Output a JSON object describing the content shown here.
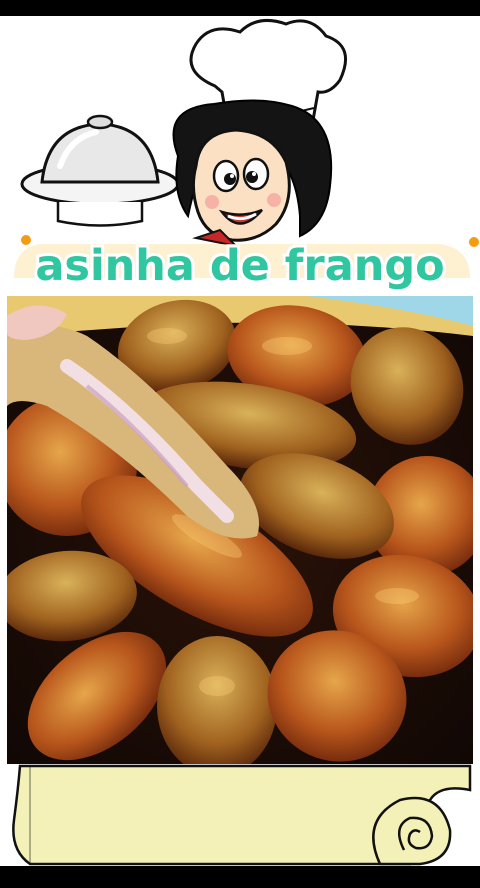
{
  "title": "asinha de frango",
  "colors": {
    "title_fill": "#2fc6a0",
    "title_stroke": "#ffffff",
    "scroll_fill": "#f3f0b8",
    "chef_hat": "#ffffff",
    "plate_dark": "#1a0f0a",
    "wing_glaze": "#b8561c"
  },
  "icons": {
    "chef": "chef-cartoon",
    "cloche": "serving-cloche",
    "scroll": "parchment-scroll"
  }
}
